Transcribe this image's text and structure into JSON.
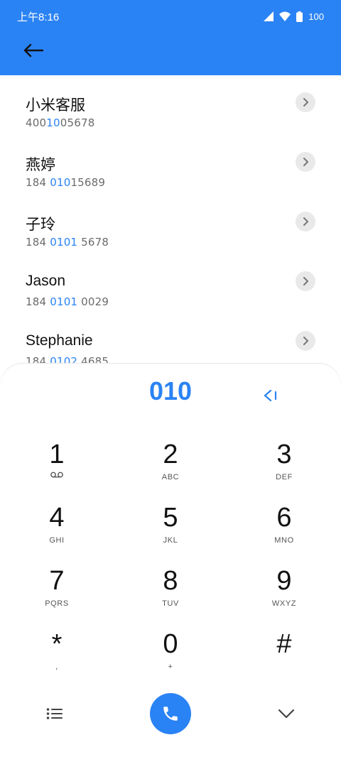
{
  "status_bar": {
    "time": "上午8:16",
    "battery": "100"
  },
  "header": {
    "back_icon": "arrow-left-icon"
  },
  "contacts": [
    {
      "name": "小米客服",
      "phone_prefix": "400",
      "phone_match": "10",
      "phone_suffix": "05678"
    },
    {
      "name": "燕婷",
      "phone_prefix": "184 ",
      "phone_match": "010",
      "phone_suffix": "15689"
    },
    {
      "name": "子玲",
      "phone_prefix": "184 ",
      "phone_match": "0101",
      "phone_suffix": " 5678"
    },
    {
      "name": "Jason",
      "phone_prefix": "184 ",
      "phone_match": "0101",
      "phone_suffix": " 0029"
    },
    {
      "name": "Stephanie",
      "phone_prefix": "184 ",
      "phone_match": "0102",
      "phone_suffix": " 4685"
    }
  ],
  "dialer": {
    "input": "010",
    "keys": [
      {
        "digit": "1",
        "letters": "",
        "icon": "voicemail-icon"
      },
      {
        "digit": "2",
        "letters": "ABC"
      },
      {
        "digit": "3",
        "letters": "DEF"
      },
      {
        "digit": "4",
        "letters": "GHI"
      },
      {
        "digit": "5",
        "letters": "JKL"
      },
      {
        "digit": "6",
        "letters": "MNO"
      },
      {
        "digit": "7",
        "letters": "PQRS"
      },
      {
        "digit": "8",
        "letters": "TUV"
      },
      {
        "digit": "9",
        "letters": "WXYZ"
      },
      {
        "digit": "*",
        "letters": ","
      },
      {
        "digit": "0",
        "letters": "+"
      },
      {
        "digit": "#",
        "letters": ""
      }
    ],
    "accent_color": "#2a83f4"
  }
}
